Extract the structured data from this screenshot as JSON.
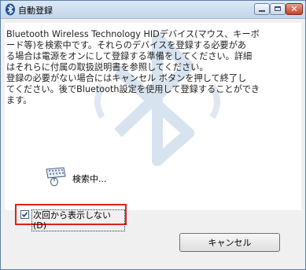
{
  "window": {
    "title": "自動登録",
    "icons": {
      "app": "bluetooth-icon",
      "minimize": "minimize-icon",
      "maximize": "maximize-icon",
      "close": "close-icon"
    }
  },
  "message": {
    "lines": [
      "Bluetooth Wireless Technology HIDデバイス(マウス、キーボ",
      "ード等)を検索中です。それらのデバイスを登録する必要があ",
      "る場合は電源をオンにして登録する準備をしてください。詳細",
      "はそれらに付属の取扱説明書を参照してください。",
      "登録の必要がない場合にはキャンセル ボタンを押して終了し",
      "てください。後でBluetooth設定を使用して登録することができ",
      "ます。"
    ]
  },
  "status": {
    "icon": "keyboard-mouse-icon",
    "text": "検索中..."
  },
  "checkbox": {
    "label": "次回から表示しない(D)",
    "checked": true
  },
  "buttons": {
    "cancel": "キャンセル"
  },
  "colors": {
    "highlight": "#e02020",
    "watermark": "#c9d9ea"
  }
}
